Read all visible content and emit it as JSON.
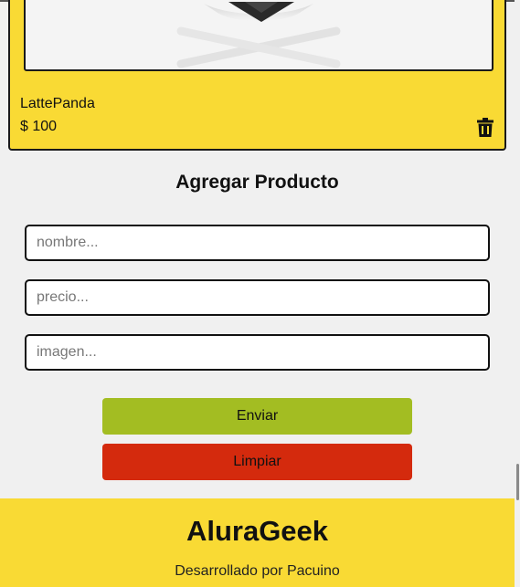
{
  "product": {
    "name": "LattePanda",
    "price": "$ 100",
    "delete_icon": "trash-icon"
  },
  "form": {
    "title": "Agregar Producto",
    "name_placeholder": "nombre...",
    "price_placeholder": "precio...",
    "image_placeholder": "imagen...",
    "send_label": "Enviar",
    "clear_label": "Limpiar"
  },
  "footer": {
    "brand": "AluraGeek",
    "credit": "Desarrollado por Pacuino"
  },
  "colors": {
    "accent_yellow": "#f9da34",
    "send_green": "#a3bd22",
    "clear_red": "#d42a0d"
  }
}
